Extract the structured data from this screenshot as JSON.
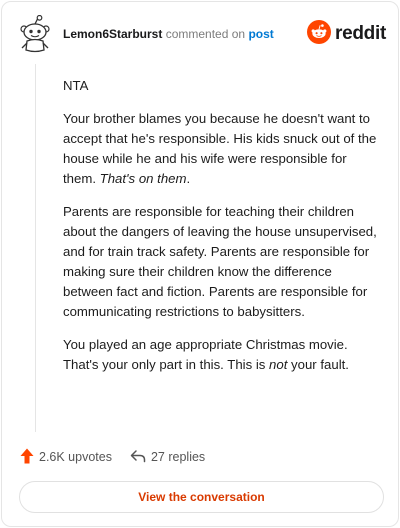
{
  "header": {
    "username": "Lemon6Starburst",
    "action_text": "commented on",
    "post_link": "post",
    "brand": "reddit"
  },
  "comment": {
    "p1": "NTA",
    "p2_a": "Your brother blames you because he doesn't want to accept that he's responsible. His kids snuck out of the house while he and his wife were responsible for them. ",
    "p2_b": "That's on them",
    "p2_c": ".",
    "p3": "Parents are responsible for teaching their children about the dangers of leaving the house unsupervised, and for train track safety. Parents are responsible for making sure their children know the difference between fact and fiction. Parents are responsible for communicating restrictions to babysitters.",
    "p4_a": "You played an age appropriate Christmas movie. That's your only part in this. This is ",
    "p4_b": "not",
    "p4_c": " your fault."
  },
  "actions": {
    "upvotes": "2.6K upvotes",
    "replies": "27 replies"
  },
  "cta": {
    "label": "View the conversation"
  },
  "colors": {
    "brand": "#ff4500",
    "upvote": "#ff4500",
    "cta_text": "#d93a00",
    "link": "#0079d3"
  },
  "icons": [
    "snoo-avatar-icon",
    "reddit-logo-icon",
    "upvote-arrow-icon",
    "reply-arrow-icon"
  ]
}
